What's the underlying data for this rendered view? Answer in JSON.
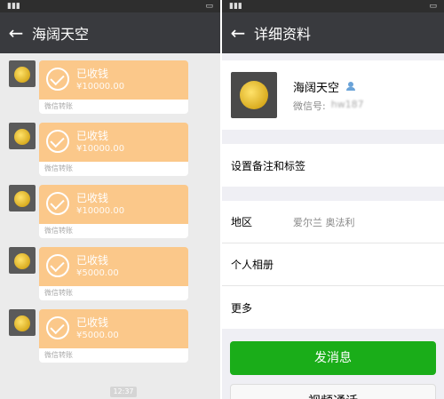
{
  "left": {
    "title": "海阔天空",
    "payments": [
      {
        "status": "已收钱",
        "amount": "¥10000.00",
        "label": "微信转账"
      },
      {
        "status": "已收钱",
        "amount": "¥10000.00",
        "label": "微信转账"
      },
      {
        "status": "已收钱",
        "amount": "¥10000.00",
        "label": "微信转账"
      },
      {
        "status": "已收钱",
        "amount": "¥5000.00",
        "label": "微信转账"
      },
      {
        "status": "已收钱",
        "amount": "¥5000.00",
        "label": "微信转账"
      }
    ],
    "time_badge": "12:37"
  },
  "right": {
    "title": "详细资料",
    "name": "海阔天空",
    "wechat_id_label": "微信号:",
    "wechat_id_value": "hw187",
    "remarks": "设置备注和标签",
    "region_label": "地区",
    "region_value": "爱尔兰  奥法利",
    "album_label": "个人相册",
    "more_label": "更多",
    "send_message": "发消息",
    "video_call": "视频通话"
  },
  "colors": {
    "navbar": "#393a3e",
    "bubble": "#fbc88a",
    "green": "#1aad19"
  }
}
